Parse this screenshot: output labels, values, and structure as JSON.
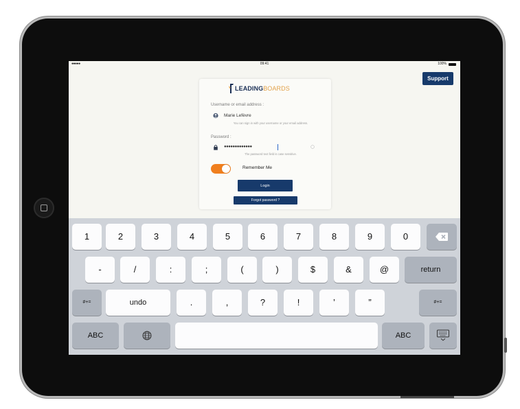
{
  "status_bar": {
    "signal": "●●●●● ",
    "time": "09:41",
    "battery": "100%"
  },
  "support_label": "Support",
  "logo": {
    "part1": "LEADING",
    "part2": "BOARDS"
  },
  "username": {
    "label": "Username or email address :",
    "value": "Marie Lefèvre",
    "hint": "You can sign in with your username or your email address."
  },
  "password": {
    "label": "Password :",
    "value": "●●●●●●●●●●●●●",
    "hint": "The password text field is case sensitive."
  },
  "remember": {
    "label": "Remember Me",
    "on": true
  },
  "login_label": "Login",
  "forgot_label": "Forgot password ?",
  "colors": {
    "brand_navy": "#173a6b",
    "toggle_orange": "#f07f1e",
    "logo_gold": "#e2a24a"
  },
  "keyboard": {
    "row1": [
      "1",
      "2",
      "3",
      "4",
      "5",
      "6",
      "7",
      "8",
      "9",
      "0"
    ],
    "row2": [
      "-",
      "/",
      ":",
      ";",
      "(",
      ")",
      "$",
      "&",
      "@"
    ],
    "return_label": "return",
    "alt_label": "#+=",
    "undo_label": "undo",
    "row3": [
      ".",
      ",",
      "?",
      "!",
      "’",
      "”"
    ],
    "abc_label": "ABC",
    "icons": {
      "delete": "backspace-icon",
      "globe": "globe-icon",
      "dismiss": "keyboard-dismiss-icon"
    }
  }
}
